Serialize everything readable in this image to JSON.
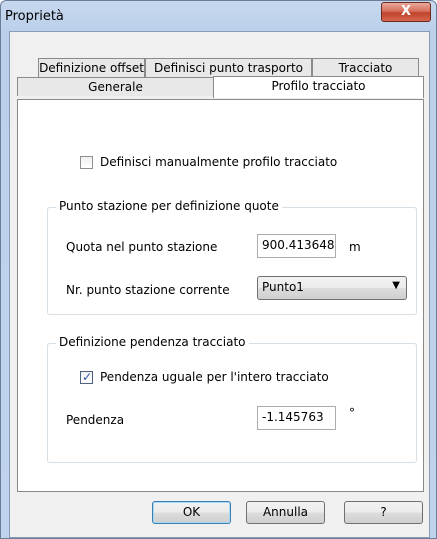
{
  "window": {
    "title": "Proprietà",
    "close_label": "X"
  },
  "tabs": {
    "row1": [
      "Definizione offset",
      "Definisci punto trasporto",
      "Tracciato"
    ],
    "row2": [
      "Generale",
      "Profilo tracciato"
    ],
    "active": "Profilo tracciato"
  },
  "manual_profile": {
    "label": "Definisci manualmente profilo tracciato",
    "checked": false
  },
  "station_group": {
    "legend": "Punto stazione per definizione quote",
    "quota_label": "Quota nel punto stazione",
    "quota_value": "900.413648",
    "quota_unit": "m",
    "point_label": "Nr. punto stazione corrente",
    "point_value": "Punto1"
  },
  "slope_group": {
    "legend": "Definizione pendenza tracciato",
    "uniform_label": "Pendenza uguale per l'intero tracciato",
    "uniform_checked": true,
    "slope_label": "Pendenza",
    "slope_value": "-1.145763",
    "slope_unit": "°"
  },
  "buttons": {
    "ok": "OK",
    "cancel": "Annulla",
    "help": "?"
  }
}
